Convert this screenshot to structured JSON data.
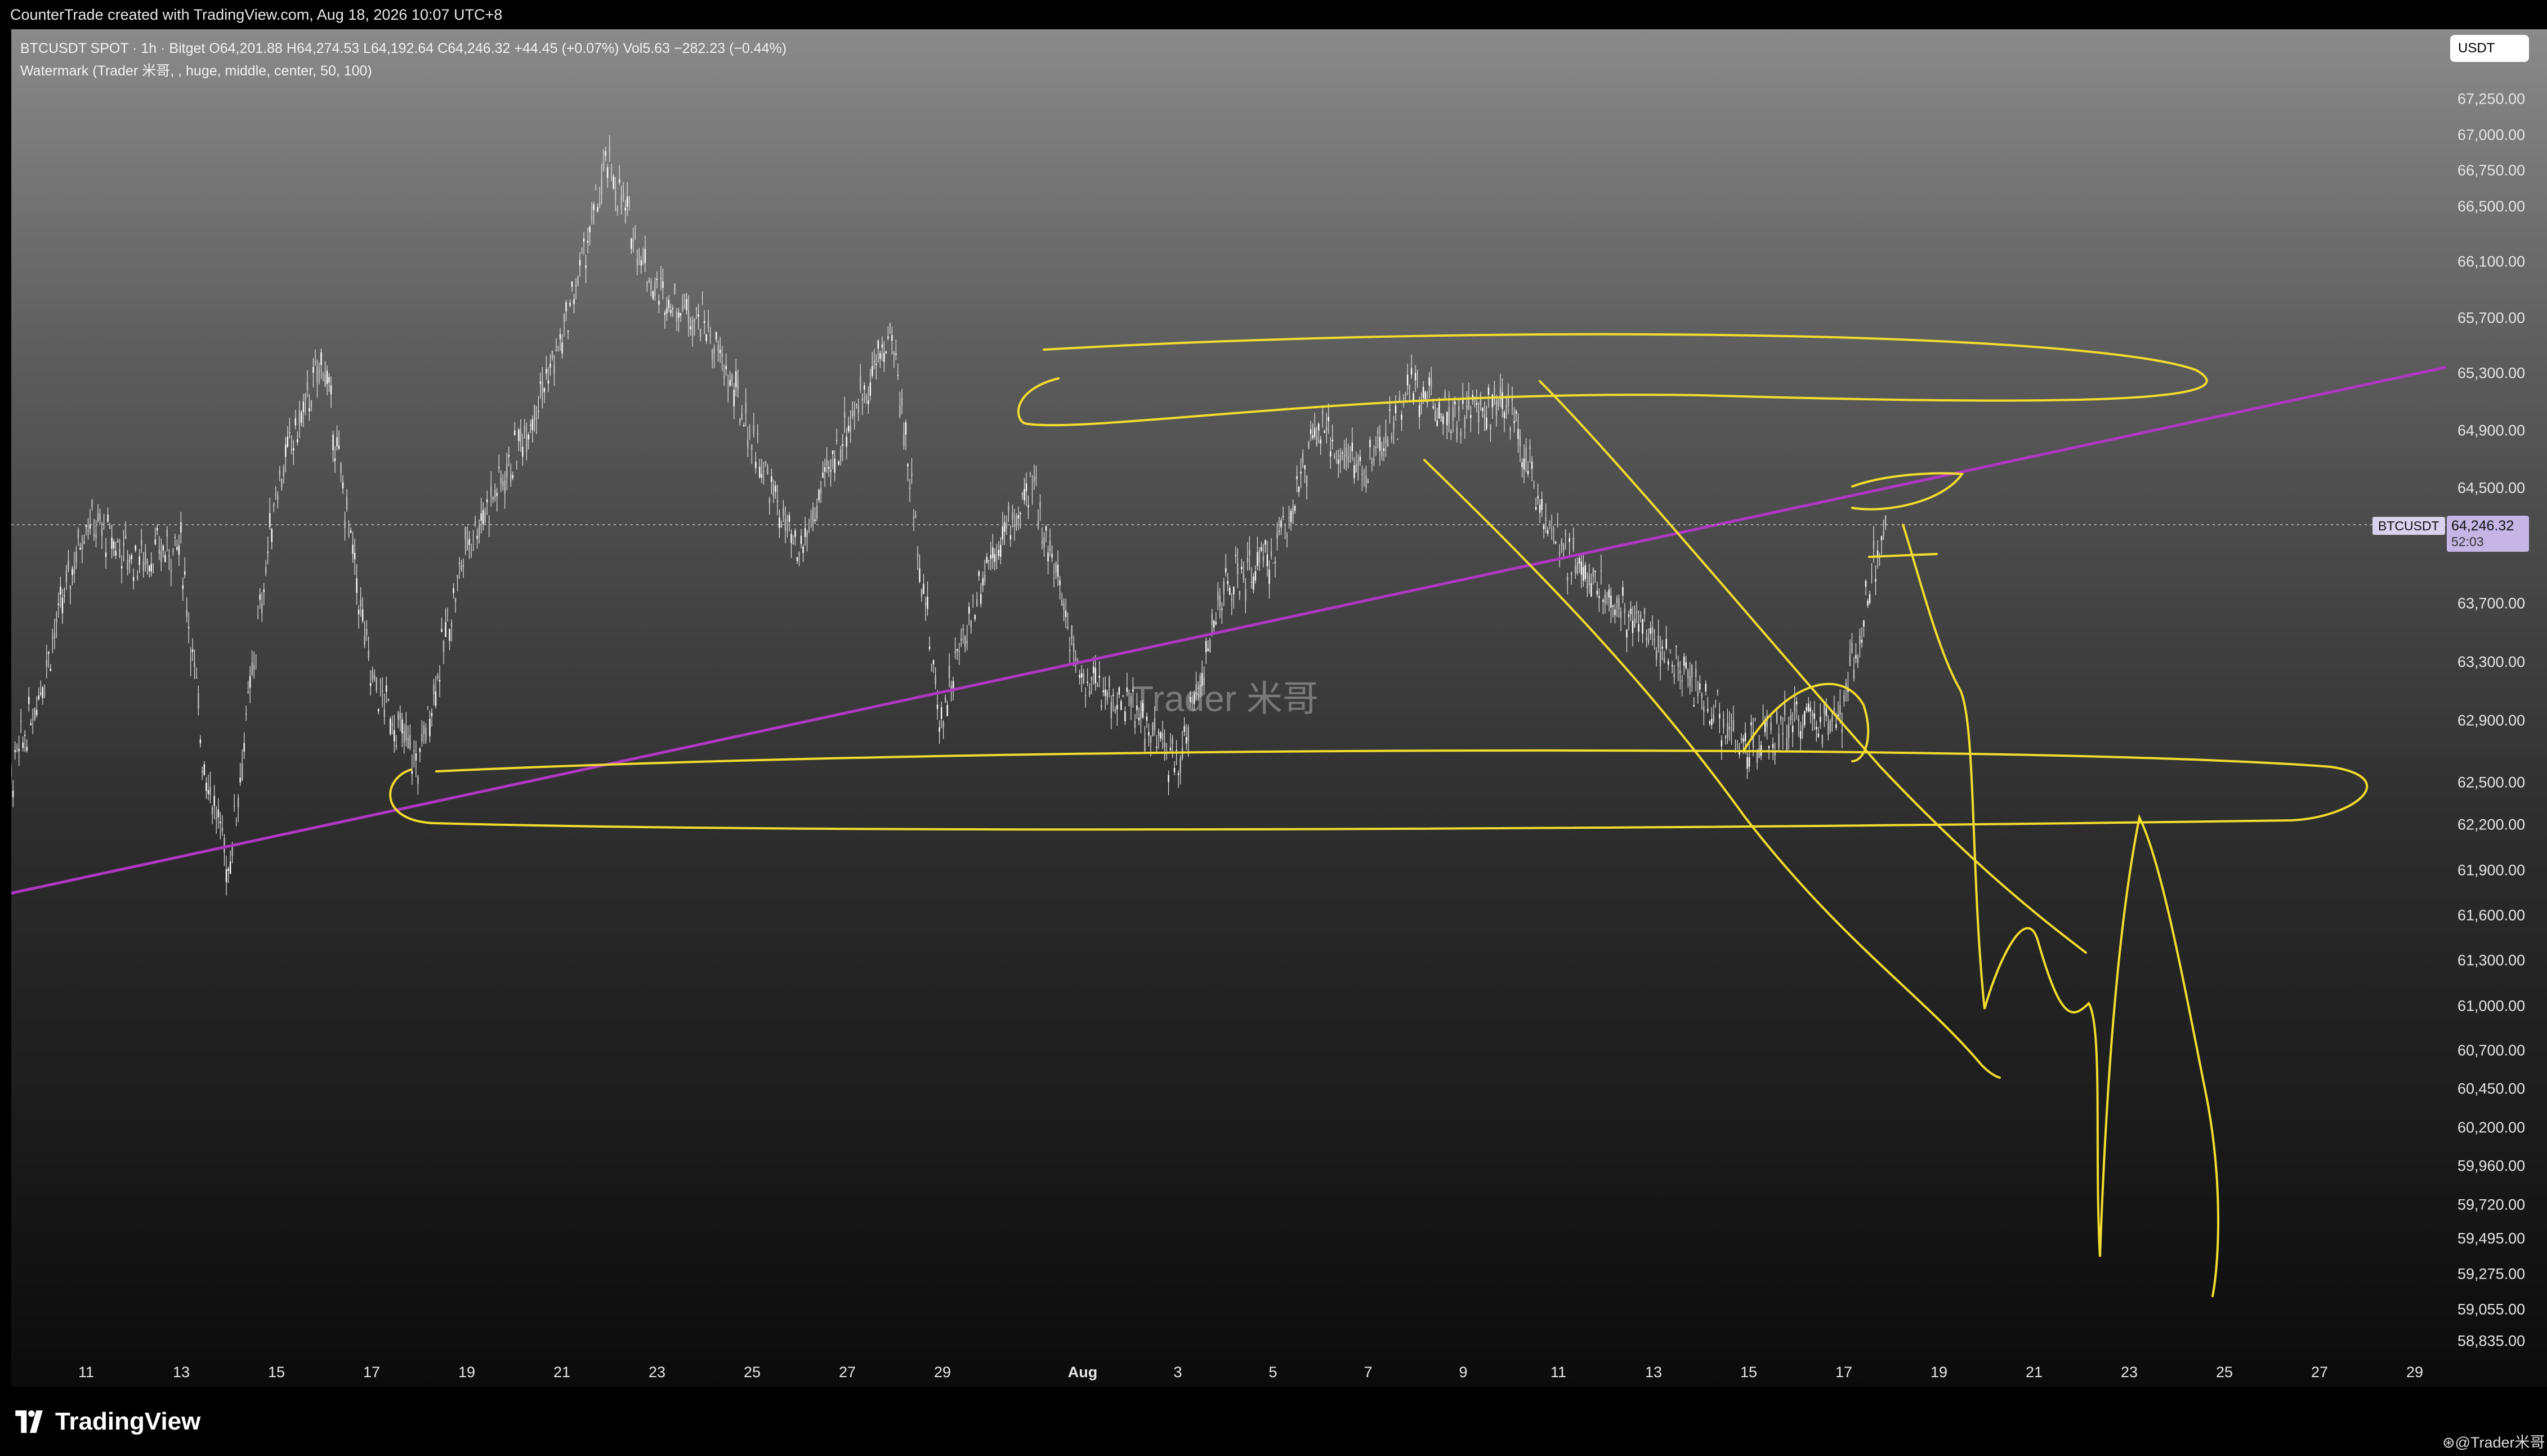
{
  "header": {
    "created_text": "CounterTrade created with TradingView.com, Aug 18, 2026 10:07 UTC+8"
  },
  "legend": {
    "line1": "BTCUSDT SPOT · 1h · Bitget  O64,201.88  H64,274.53  L64,192.64  C64,246.32  +44.45 (+0.07%)  Vol5.63  −282.23 (−0.44%)",
    "line2": "Watermark (Trader 米哥, , huge, middle, center, 50, 100)"
  },
  "currency_button": "USDT",
  "watermark_text": "Trader 米哥",
  "current_price": {
    "symbol": "BTCUSDT",
    "price": "64,246.32",
    "countdown": "52:03",
    "value": 64246.32
  },
  "price_axis": {
    "labels": [
      "67,250.00",
      "67,000.00",
      "66,750.00",
      "66,500.00",
      "66,100.00",
      "65,700.00",
      "65,300.00",
      "64,900.00",
      "64,500.00",
      "63,700.00",
      "63,300.00",
      "62,900.00",
      "62,500.00",
      "62,200.00",
      "61,900.00",
      "61,600.00",
      "61,300.00",
      "61,000.00",
      "60,700.00",
      "60,450.00",
      "60,200.00",
      "59,960.00",
      "59,720.00",
      "59,495.00",
      "59,275.00",
      "59,055.00",
      "58,835.00"
    ],
    "values": [
      67250,
      67000,
      66750,
      66500,
      66100,
      65700,
      65300,
      64900,
      64500,
      63700,
      63300,
      62900,
      62500,
      62200,
      61900,
      61600,
      61300,
      61000,
      60700,
      60450,
      60200,
      59960,
      59720,
      59495,
      59275,
      59055,
      58835
    ]
  },
  "time_axis": {
    "labels": [
      "11",
      "13",
      "15",
      "17",
      "19",
      "21",
      "23",
      "25",
      "27",
      "29",
      "Aug",
      "3",
      "5",
      "7",
      "9",
      "11",
      "13",
      "15",
      "17",
      "19",
      "21",
      "23",
      "25",
      "27",
      "29"
    ]
  },
  "chart_data": {
    "type": "line",
    "symbol": "BTCUSDT",
    "timeframe": "1h",
    "x_unit": "day",
    "x_range": [
      "Jul 9",
      "Aug 30"
    ],
    "ylim": [
      58700,
      67500
    ],
    "price_path": {
      "x": [
        "Jul 9",
        "Jul 10",
        "Jul 11",
        "Jul 12",
        "Jul 13",
        "Jul 13",
        "Jul 14",
        "Jul 15",
        "Jul 16",
        "Jul 17",
        "Jul 18",
        "Jul 19",
        "Jul 20",
        "Jul 21",
        "Jul 22",
        "Jul 23",
        "Jul 24",
        "Jul 25",
        "Jul 26",
        "Jul 27",
        "Jul 28",
        "Jul 29",
        "Jul 30",
        "Jul 31",
        "Aug 1",
        "Aug 2",
        "Aug 3",
        "Aug 4",
        "Aug 5",
        "Aug 6",
        "Aug 7",
        "Aug 8",
        "Aug 9",
        "Aug 10",
        "Aug 11",
        "Aug 12",
        "Aug 13",
        "Aug 14",
        "Aug 15",
        "Aug 16",
        "Aug 17",
        "Aug 18"
      ],
      "y": [
        62100,
        63100,
        64300,
        64000,
        64100,
        62700,
        61900,
        64500,
        65400,
        63200,
        62600,
        64100,
        64700,
        65500,
        66800,
        65900,
        65700,
        64900,
        64000,
        64900,
        65600,
        62900,
        64000,
        64500,
        63200,
        63000,
        62600,
        63800,
        64000,
        64900,
        64600,
        65200,
        65000,
        65100,
        64100,
        63800,
        63500,
        63100,
        62700,
        62900,
        62900,
        64400
      ]
    },
    "trendline": {
      "x": [
        "Jul 9",
        "Aug 30"
      ],
      "y": [
        61720,
        65360
      ],
      "color": "#b037c4"
    },
    "annotation_color": "#f2dd2e",
    "annotations": [
      "resistance ellipse near 64,900–65,700",
      "support ellipse near 62,200–62,700",
      "descending channel lines from Aug 8 high",
      "projected drawn path falling toward 59,100"
    ],
    "grid": false
  }
}
